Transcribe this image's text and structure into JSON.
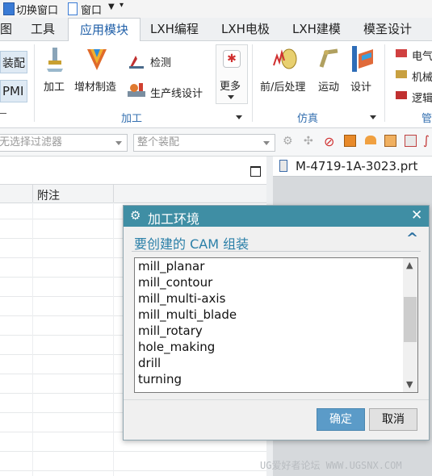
{
  "title_bar": {
    "switch_window": "切换窗口",
    "window_menu": "窗口"
  },
  "menu_tabs": [
    {
      "label": "图"
    },
    {
      "label": "工具"
    },
    {
      "label": "应用模块"
    },
    {
      "label": "LXH编程"
    },
    {
      "label": "LXH电极"
    },
    {
      "label": "LXH建模"
    },
    {
      "label": "模圣设计"
    }
  ],
  "ribbon": {
    "left_assembly": "装配",
    "left_pmi": "PMI",
    "machining_label": "加工",
    "additive_label": "增材制造",
    "inspect_label": "检测",
    "line_design_label": "生产线设计",
    "more_label": "更多",
    "group_machining": "加工",
    "prepost_label": "前/后处理",
    "motion_label": "运动",
    "design_label": "设计",
    "group_simulation": "仿真",
    "electrical_label": "电气",
    "mechanical_label": "机械",
    "logic_label": "逻辑",
    "group_partial": "管"
  },
  "filter_bar": {
    "type_filter": "无选择过滤器",
    "scope_filter": "整个装配"
  },
  "navigator": {
    "column_note": "附注"
  },
  "graphics_tab": {
    "file": "M-4719-1A-3023.prt"
  },
  "dialog": {
    "title": "加工环境",
    "section": "要创建的 CAM 组装",
    "items": [
      "mill_planar",
      "mill_contour",
      "mill_multi-axis",
      "mill_multi_blade",
      "mill_rotary",
      "hole_making",
      "drill",
      "turning"
    ],
    "ok": "确定",
    "cancel": "取消"
  },
  "watermark": "UG爱好者论坛 WWW.UGSNX.COM"
}
